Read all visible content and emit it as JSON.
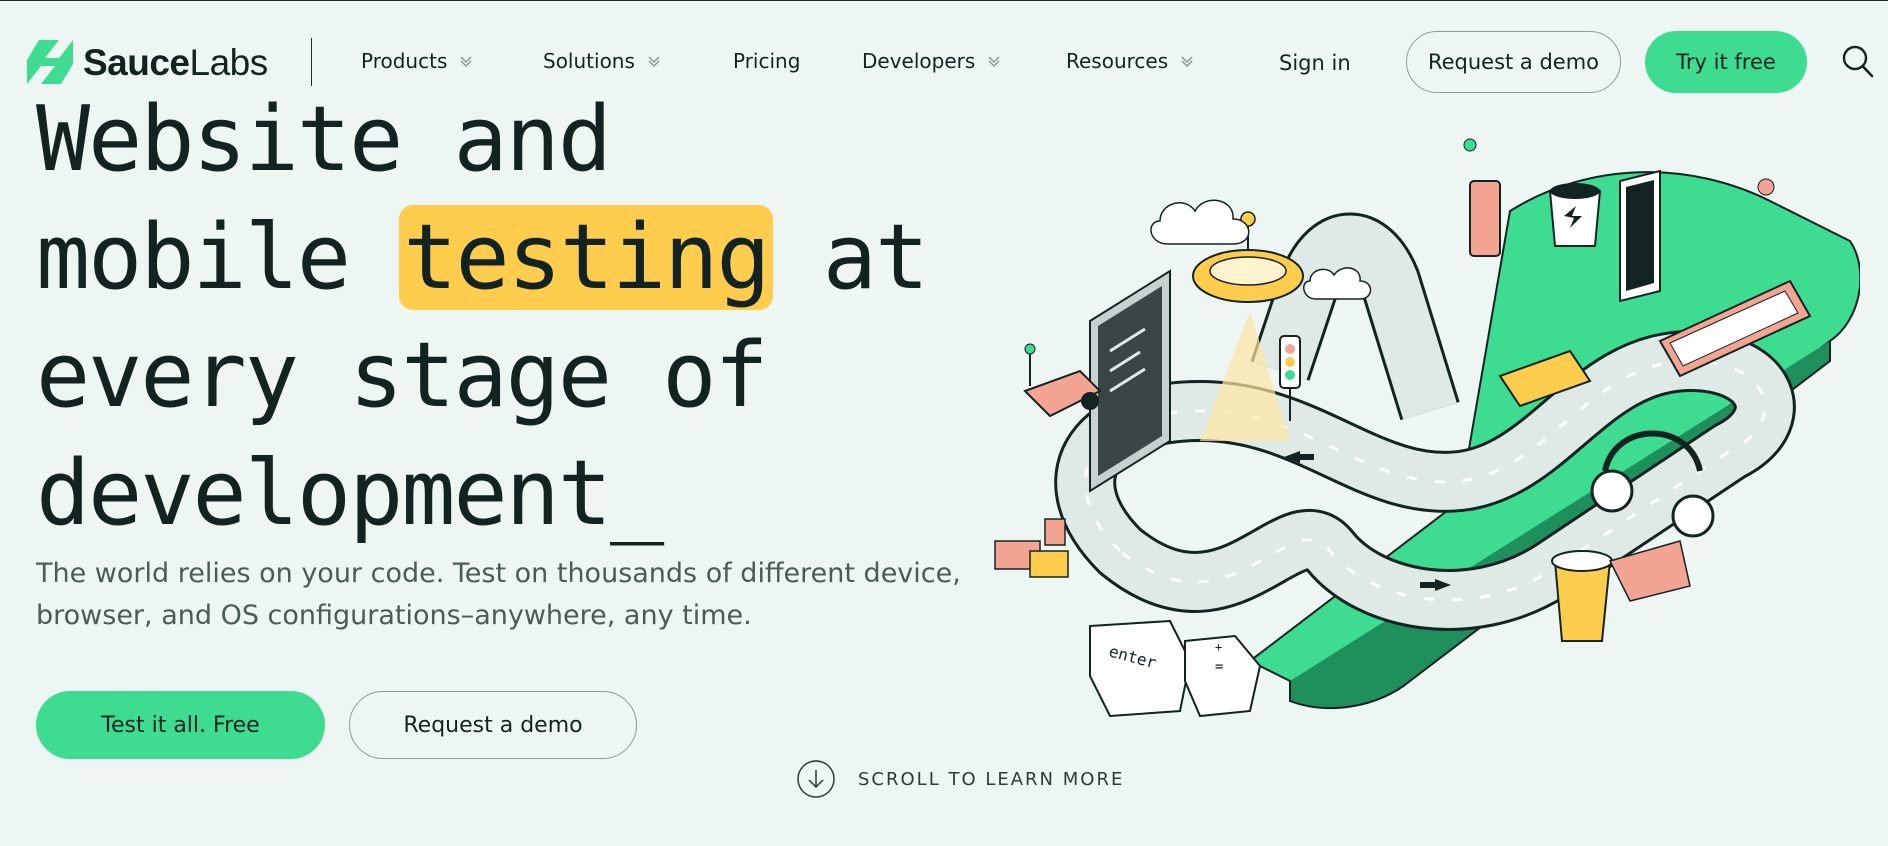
{
  "brand": {
    "name_bold": "Sauce",
    "name_light": "Labs",
    "accent": "#3ddc91",
    "highlight": "#ffcd4d"
  },
  "nav": {
    "items": [
      {
        "label": "Products",
        "has_dropdown": true
      },
      {
        "label": "Solutions",
        "has_dropdown": true
      },
      {
        "label": "Pricing",
        "has_dropdown": false
      },
      {
        "label": "Developers",
        "has_dropdown": true
      },
      {
        "label": "Resources",
        "has_dropdown": true
      }
    ],
    "sign_in": "Sign in",
    "request_demo": "Request a demo",
    "try_free": "Try it free",
    "search_icon": "search-icon"
  },
  "hero": {
    "title_line1": "Website and",
    "title_line2_pre": "mobile ",
    "title_line2_highlight": "testing",
    "title_line2_post": " at",
    "title_line3": "every stage of",
    "title_line4": "development_",
    "subtitle": "The world relies on your code. Test on thousands of different device, browser, and OS configurations–anywhere, any time.",
    "cta_primary": "Test it all. Free",
    "cta_secondary": "Request a demo",
    "scroll_label": "SCROLL TO LEARN MORE",
    "illustration_keys": [
      "enter",
      "+",
      "="
    ]
  }
}
